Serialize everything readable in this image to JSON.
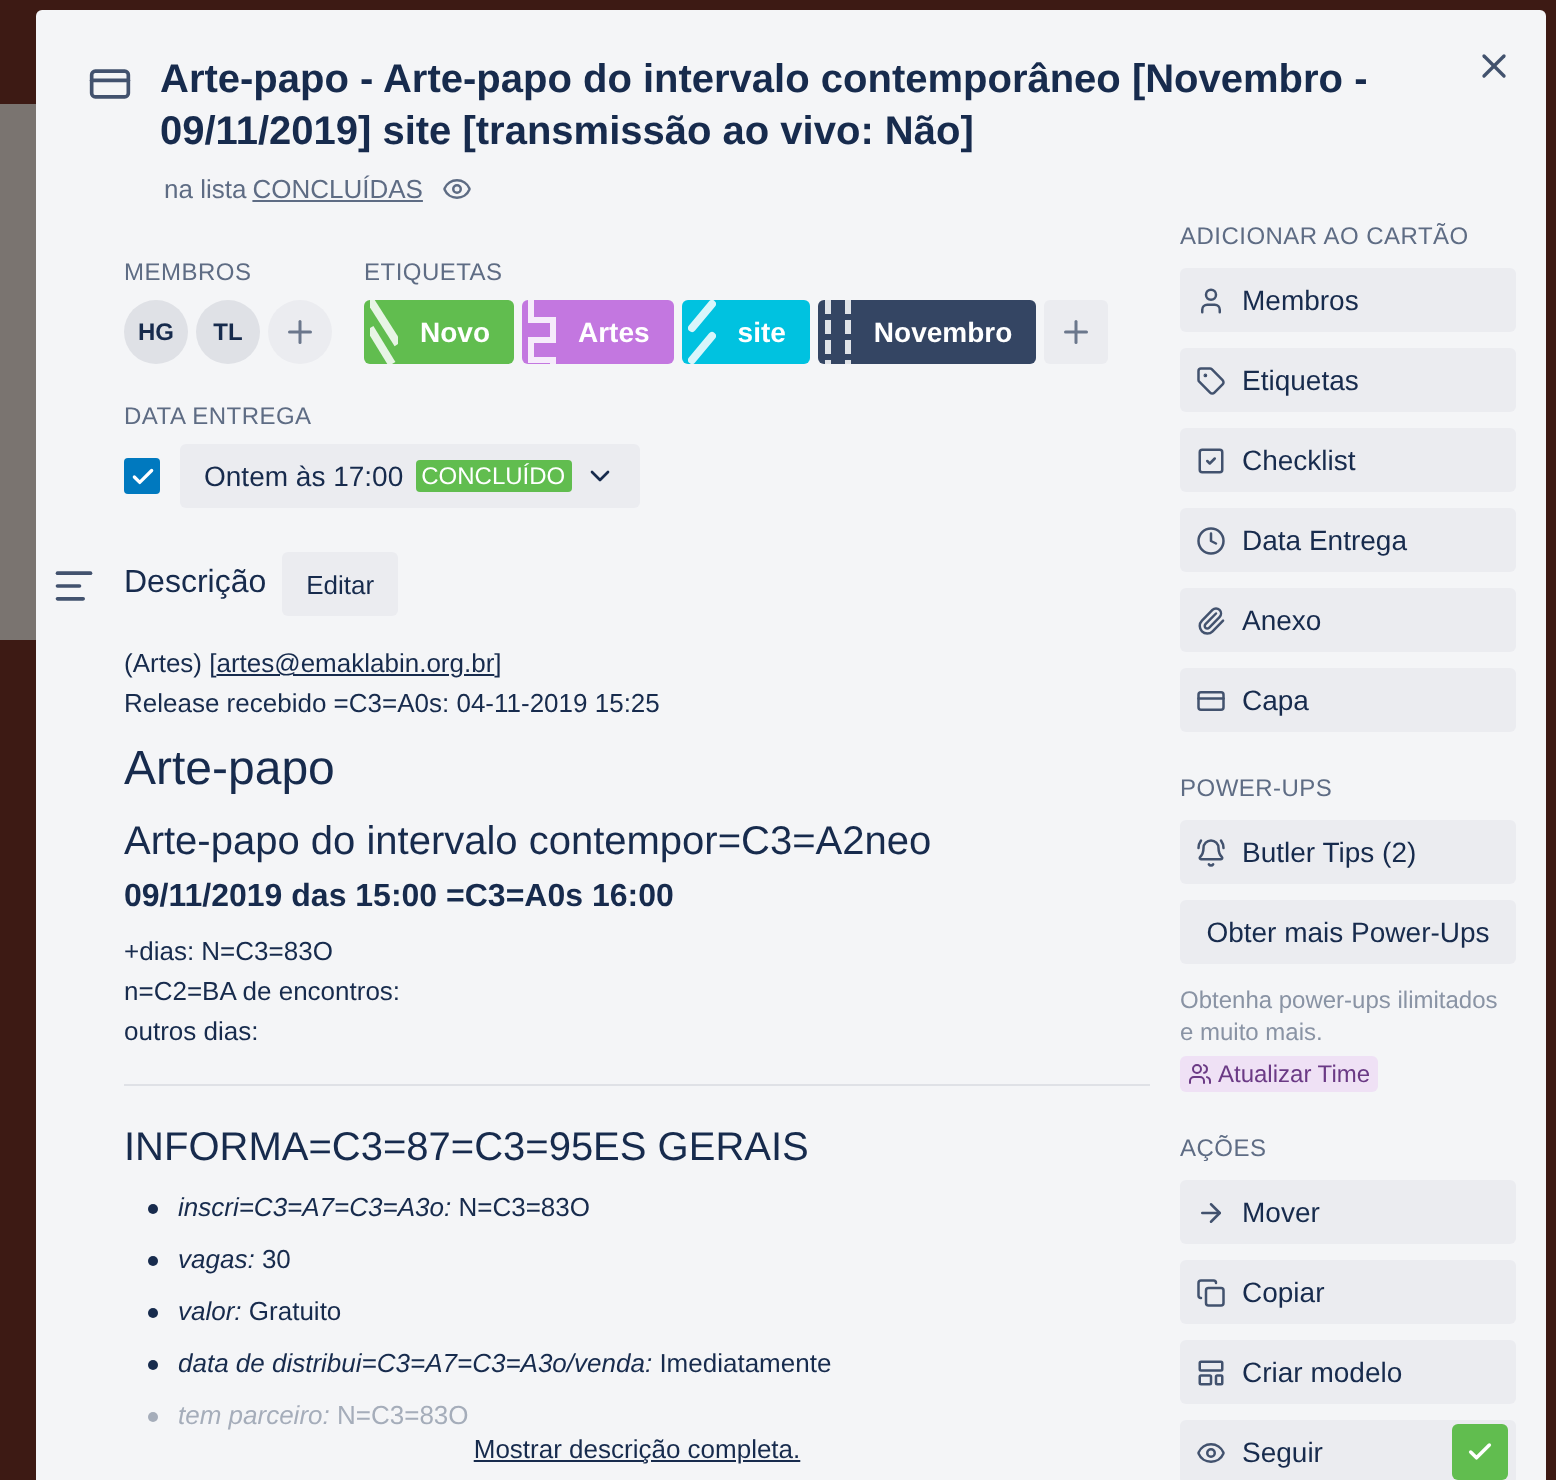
{
  "card": {
    "title": "Arte-papo - Arte-papo do intervalo contemporâneo [Novembro - 09/11/2019] site [transmissão ao vivo: Não]",
    "list_prefix": "na lista",
    "list_name": "CONCLUÍDAS"
  },
  "members": {
    "heading": "MEMBROS",
    "avatars": [
      "HG",
      "TL"
    ]
  },
  "labels": {
    "heading": "ETIQUETAS",
    "items": [
      {
        "text": "Novo",
        "color": "#61bd4f"
      },
      {
        "text": "Artes",
        "color": "#c377e0"
      },
      {
        "text": "site",
        "color": "#00c2e0"
      },
      {
        "text": "Novembro",
        "color": "#344563"
      }
    ]
  },
  "due": {
    "heading": "DATA ENTREGA",
    "checked": true,
    "date": "Ontem às 17:00",
    "badge": "CONCLUÍDO"
  },
  "description": {
    "heading": "Descrição",
    "edit": "Editar",
    "blocks": [
      {
        "kind": "link_line",
        "prefix": "(Artes) [",
        "link": "artes@emaklabin.org.br",
        "suffix": "]"
      },
      {
        "kind": "line",
        "text": "Release recebido =C3=A0s: 04-11-2019 15:25"
      },
      {
        "kind": "h1",
        "text": "Arte-papo"
      },
      {
        "kind": "h2",
        "text": "Arte-papo do intervalo contempor=C3=A2neo"
      },
      {
        "kind": "h3",
        "text": "09/11/2019 das 15:00 =C3=A0s 16:00"
      },
      {
        "kind": "line",
        "text": "+dias: N=C3=83O"
      },
      {
        "kind": "line",
        "text": "n=C2=BA de encontros:"
      },
      {
        "kind": "line",
        "text": "outros dias:"
      },
      {
        "kind": "rule"
      },
      {
        "kind": "h2",
        "text": "INFORMA=C3=87=C3=95ES GERAIS"
      },
      {
        "kind": "item",
        "label": "inscri=C3=A7=C3=A3o:",
        "value": "N=C3=83O",
        "faded": false
      },
      {
        "kind": "item",
        "label": "vagas:",
        "value": "30",
        "faded": false
      },
      {
        "kind": "item",
        "label": "valor:",
        "value": "Gratuito",
        "faded": false
      },
      {
        "kind": "item",
        "label": "data de distribui=C3=A7=C3=A3o/venda:",
        "value": "Imediatamente",
        "faded": false
      },
      {
        "kind": "item",
        "label": "tem parceiro:",
        "value": "N=C3=83O",
        "faded": true
      }
    ],
    "show_full": "Mostrar descrição completa."
  },
  "sidebar": [
    {
      "heading": "ADICIONAR AO CARTÃO",
      "buttons": [
        {
          "kind": "user",
          "label": "Membros",
          "checked": false
        },
        {
          "kind": "tag",
          "label": "Etiquetas",
          "checked": false
        },
        {
          "kind": "checklist",
          "label": "Checklist",
          "checked": false
        },
        {
          "kind": "clock",
          "label": "Data Entrega",
          "checked": false
        },
        {
          "kind": "paperclip",
          "label": "Anexo",
          "checked": false
        },
        {
          "kind": "cover",
          "label": "Capa",
          "checked": false
        }
      ]
    },
    {
      "heading": "POWER-UPS",
      "buttons": [
        {
          "kind": "bell",
          "label": "Butler Tips (2)",
          "checked": false
        },
        {
          "kind": "plain",
          "label": "Obter mais Power-Ups",
          "checked": false
        }
      ],
      "note": "Obtenha power-ups ilimitados e muito mais.",
      "upgrade": "Atualizar Time"
    },
    {
      "heading": "AÇÕES",
      "buttons": [
        {
          "kind": "arrow",
          "label": "Mover",
          "checked": false
        },
        {
          "kind": "copy",
          "label": "Copiar",
          "checked": false
        },
        {
          "kind": "template",
          "label": "Criar modelo",
          "checked": false
        },
        {
          "kind": "eye",
          "label": "Seguir",
          "checked": true
        }
      ]
    }
  ]
}
